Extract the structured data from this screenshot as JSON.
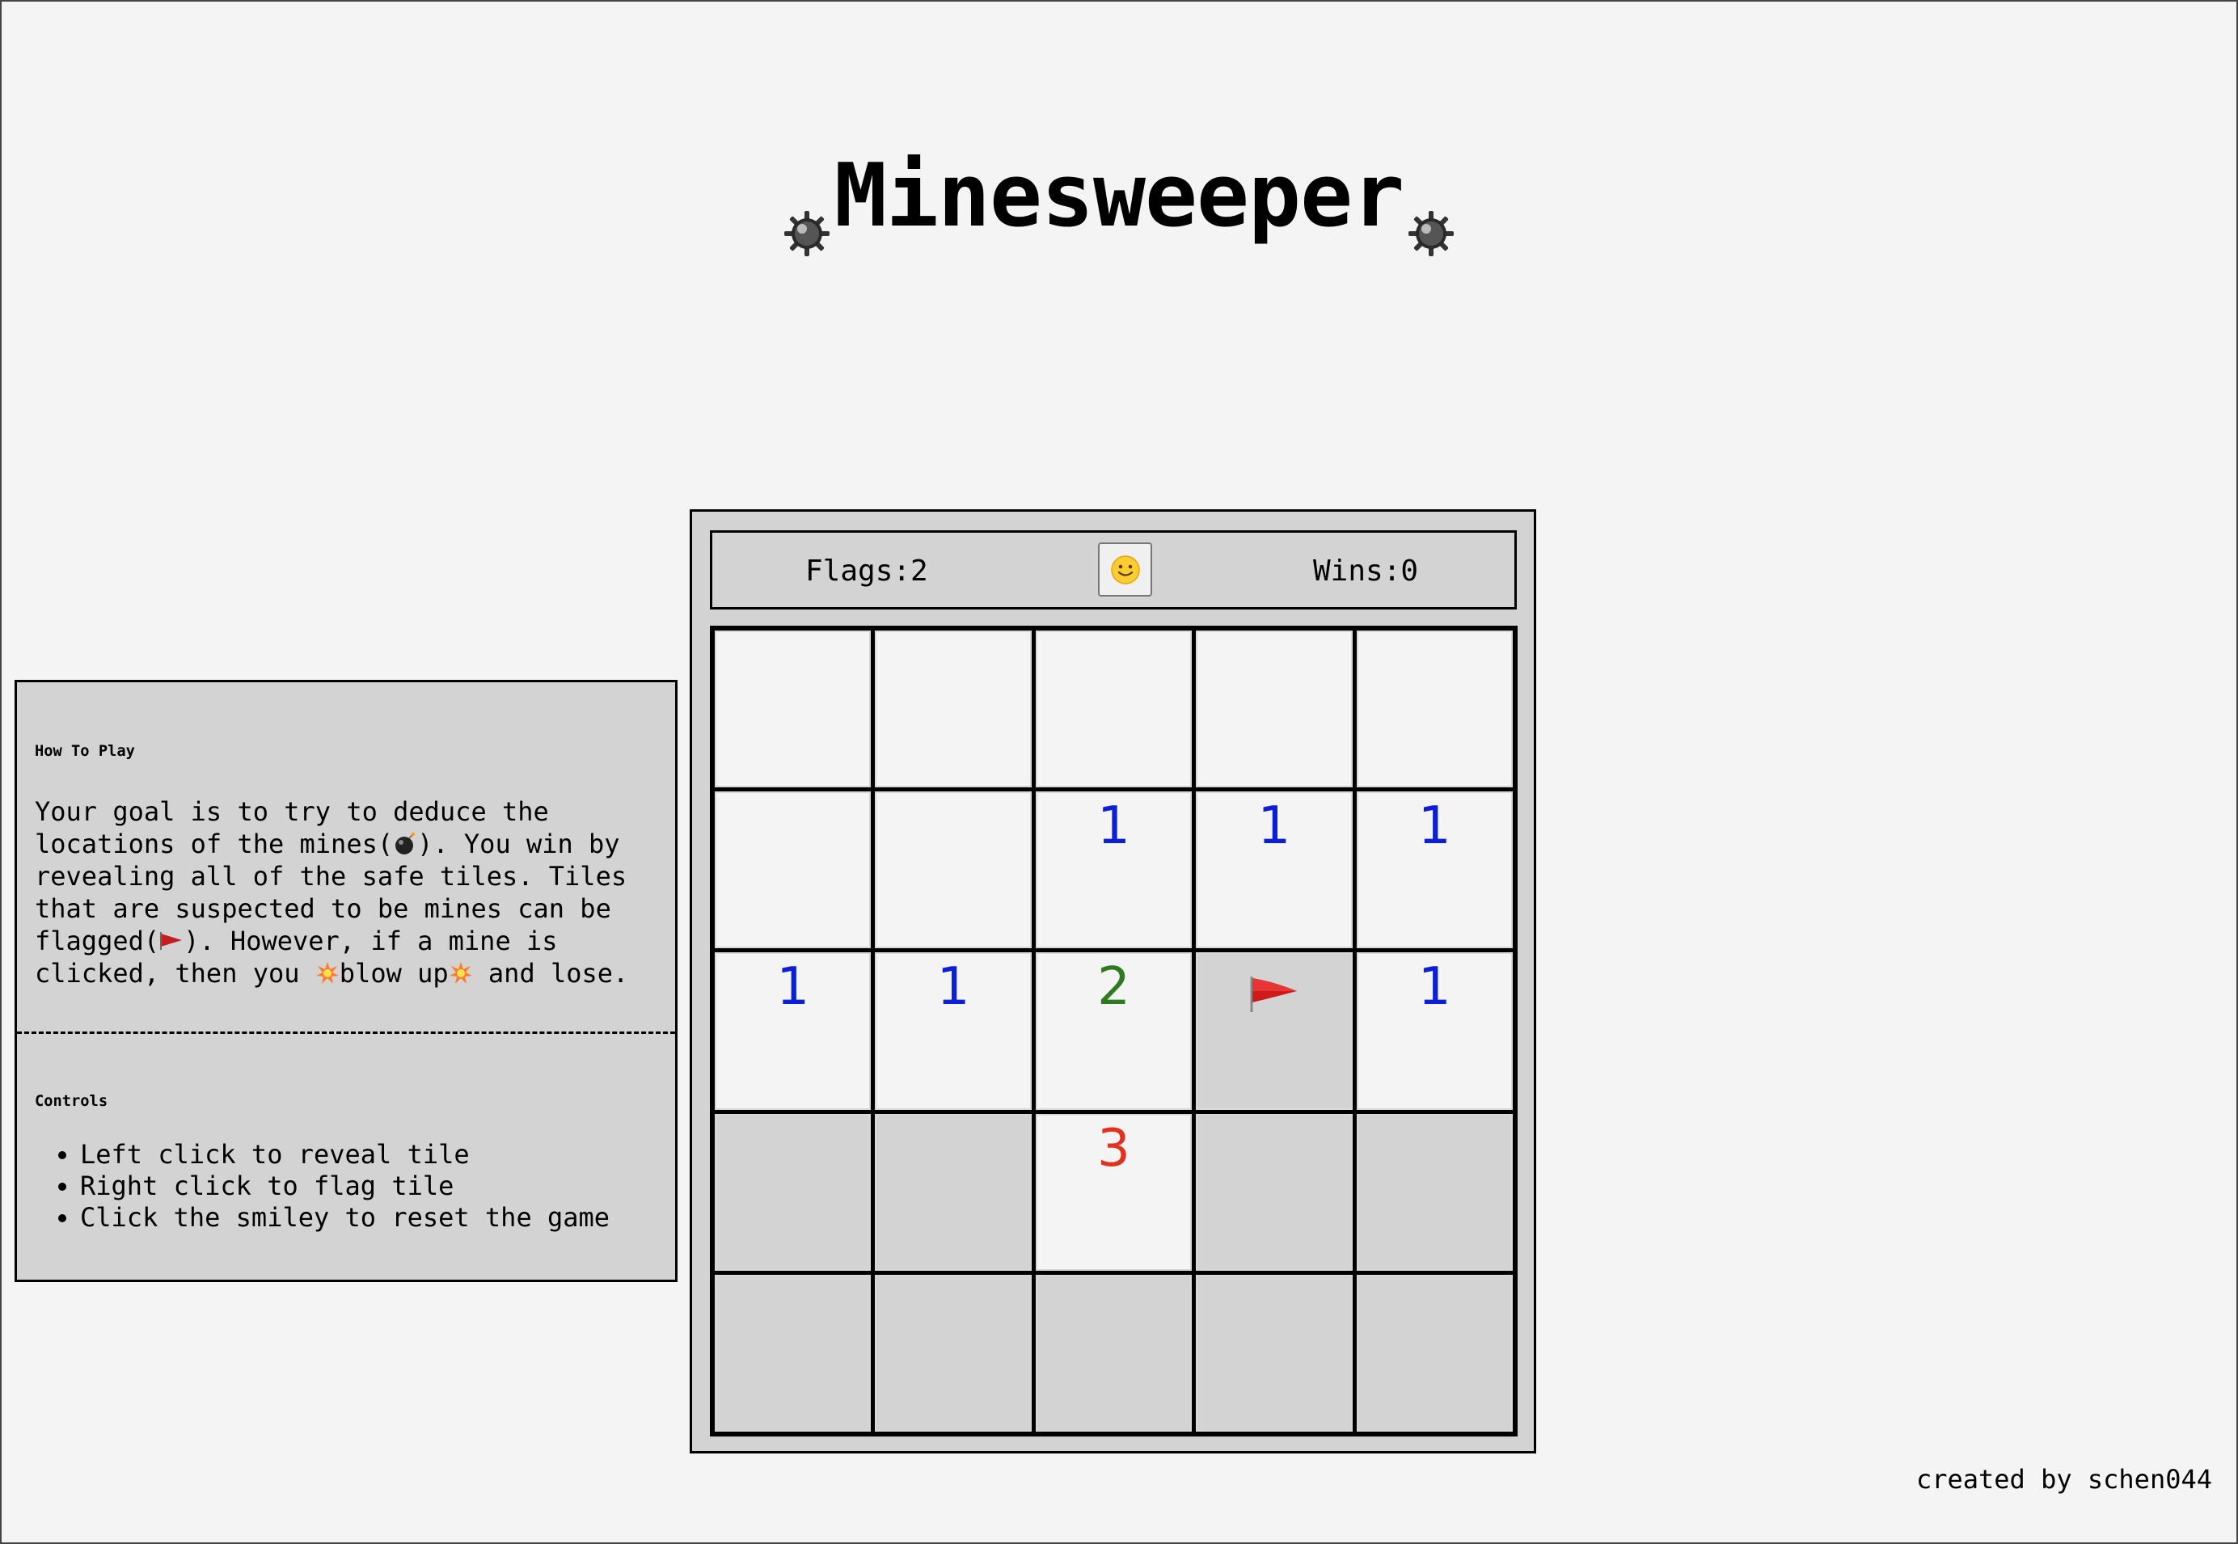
{
  "title": "Minesweeper",
  "how_to_play": {
    "heading": "How To Play",
    "text_part1": "Your goal is to try to deduce the\nlocations of the mines(",
    "text_part2": "). You win by\nrevealing all of the safe tiles. Tiles\nthat are suspected to be mines can be\nflagged(",
    "text_part3": "). However, if a mine is\nclicked, then you ",
    "text_part4": "blow up",
    "text_part5": " and lose."
  },
  "controls": {
    "heading": "Controls",
    "items": [
      "Left click to reveal tile",
      "Right click to flag tile",
      "Click the smiley to reset the game"
    ]
  },
  "status": {
    "flags_label": "Flags:2",
    "wins_label": "Wins:0",
    "smiley": "🙂"
  },
  "board": {
    "rows": [
      [
        {
          "state": "revealed",
          "value": ""
        },
        {
          "state": "revealed",
          "value": ""
        },
        {
          "state": "revealed",
          "value": ""
        },
        {
          "state": "revealed",
          "value": ""
        },
        {
          "state": "revealed",
          "value": ""
        }
      ],
      [
        {
          "state": "revealed",
          "value": ""
        },
        {
          "state": "revealed",
          "value": ""
        },
        {
          "state": "revealed",
          "value": "1"
        },
        {
          "state": "revealed",
          "value": "1"
        },
        {
          "state": "revealed",
          "value": "1"
        }
      ],
      [
        {
          "state": "revealed",
          "value": "1"
        },
        {
          "state": "revealed",
          "value": "1"
        },
        {
          "state": "revealed",
          "value": "2"
        },
        {
          "state": "flagged",
          "value": ""
        },
        {
          "state": "revealed",
          "value": "1"
        }
      ],
      [
        {
          "state": "hidden",
          "value": ""
        },
        {
          "state": "hidden",
          "value": ""
        },
        {
          "state": "revealed",
          "value": "3"
        },
        {
          "state": "hidden",
          "value": ""
        },
        {
          "state": "hidden",
          "value": ""
        }
      ],
      [
        {
          "state": "hidden",
          "value": ""
        },
        {
          "state": "hidden",
          "value": ""
        },
        {
          "state": "hidden",
          "value": ""
        },
        {
          "state": "hidden",
          "value": ""
        },
        {
          "state": "hidden",
          "value": ""
        }
      ]
    ],
    "number_colors": {
      "1": "#0a1fd6",
      "2": "#2e7a1e",
      "3": "#e0321e"
    }
  },
  "credit": "created by schen044",
  "colors": {
    "page_bg": "#f4f4f4",
    "panel_bg": "#d3d3d3",
    "revealed_bg": "#f4f4f4"
  }
}
